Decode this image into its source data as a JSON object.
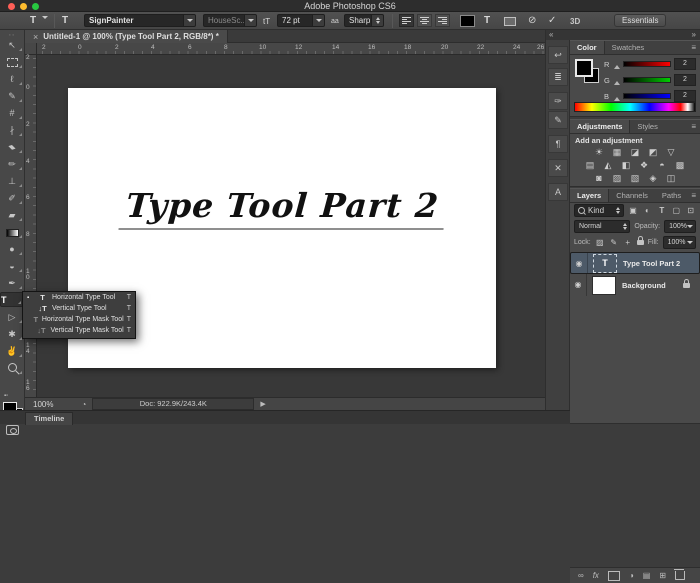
{
  "titlebar": {
    "title": "Adobe Photoshop CS6"
  },
  "colors": {
    "mac_red": "#ff5f57",
    "mac_yellow": "#febc2e",
    "mac_green": "#28c840",
    "panel": "#4a4a4a",
    "canvas": "#ffffff",
    "selected_layer_row": "#4d5a68",
    "foreground_color": "#000000"
  },
  "options_bar": {
    "tool_preset_glyph": "T",
    "orientation_glyph": "T",
    "font_family": {
      "value": "SignPainter"
    },
    "font_style": {
      "value": "HouseSc..."
    },
    "size_icon": "tT",
    "font_size": {
      "value": "72 pt"
    },
    "anti_alias_icon": "aa",
    "anti_alias": {
      "value": "Sharp"
    },
    "cancel_glyph": "⊘",
    "commit_glyph": "✓",
    "threed_label": "3D",
    "workspace_label": "Essentials"
  },
  "toolbar": {
    "grip": "∙∙",
    "tools": [
      {
        "name": "move",
        "glyph": "↖"
      },
      {
        "name": "rectangular-marquee",
        "glyph": ""
      },
      {
        "name": "lasso",
        "glyph": "ℓ"
      },
      {
        "name": "quick-selection",
        "glyph": "✎"
      },
      {
        "name": "crop",
        "glyph": "#"
      },
      {
        "name": "eyedropper",
        "glyph": "∤"
      },
      {
        "name": "healing-brush",
        "glyph": "▰"
      },
      {
        "name": "brush",
        "glyph": "✏"
      },
      {
        "name": "clone-stamp",
        "glyph": "⊥"
      },
      {
        "name": "history-brush",
        "glyph": "✐"
      },
      {
        "name": "eraser",
        "glyph": "▰"
      },
      {
        "name": "gradient",
        "glyph": ""
      },
      {
        "name": "blur",
        "glyph": "●"
      },
      {
        "name": "dodge",
        "glyph": "◒"
      },
      {
        "name": "pen",
        "glyph": "✒"
      },
      {
        "name": "type",
        "glyph": "T"
      },
      {
        "name": "path-selection",
        "glyph": "▷"
      },
      {
        "name": "custom-shape",
        "glyph": "✱"
      },
      {
        "name": "hand",
        "glyph": "✌"
      },
      {
        "name": "zoom",
        "glyph": ""
      }
    ]
  },
  "tool_flyout": {
    "bullet": "▪",
    "items": [
      {
        "icon": "T",
        "label": "Horizontal Type Tool",
        "shortcut": "T",
        "selected": true
      },
      {
        "icon": "↓T",
        "label": "Vertical Type Tool",
        "shortcut": "T",
        "selected": false
      },
      {
        "icon": "T",
        "label": "Horizontal Type Mask Tool",
        "shortcut": "T",
        "selected": false
      },
      {
        "icon": "↓T",
        "label": "Vertical Type Mask Tool",
        "shortcut": "T",
        "selected": false
      }
    ]
  },
  "document": {
    "tab": {
      "close": "×",
      "title": "Untitled-1 @ 100% (Type Tool Part 2, RGB/8*) *"
    },
    "canvas_text": "Type Tool Part 2",
    "ruler_h": [
      "2",
      "0",
      "2",
      "4",
      "6",
      "8",
      "10",
      "12",
      "14",
      "16",
      "18",
      "20",
      "22",
      "24",
      "26"
    ],
    "ruler_v": [
      "2",
      "0",
      "2",
      "4",
      "6",
      "8",
      "1\n0",
      "1\n2",
      "1\n4",
      "1\n6"
    ],
    "status": {
      "zoom": "100%",
      "badge": "◔",
      "doc": "Doc: 922.9K/243.4K",
      "arrow": "▶"
    }
  },
  "timeline": {
    "tab_label": "Timeline"
  },
  "dock_strip": {
    "collapse_glyph": "«",
    "icons": [
      {
        "name": "history-panel",
        "glyph": "↩"
      },
      {
        "name": "properties-panel",
        "glyph": "≣"
      },
      {
        "name": "brush-panel",
        "glyph": "✑"
      },
      {
        "name": "brush-presets-panel",
        "glyph": "✎"
      },
      {
        "name": "paragraph-panel",
        "glyph": "¶"
      },
      {
        "name": "tool-presets-panel",
        "glyph": "✕"
      },
      {
        "name": "character-panel",
        "glyph": "A"
      }
    ]
  },
  "panels": {
    "collapse_glyph": "»",
    "color": {
      "tabs": [
        "Color",
        "Swatches"
      ],
      "menu_icon": "≡",
      "channels": [
        {
          "label": "R",
          "value": "2"
        },
        {
          "label": "G",
          "value": "2"
        },
        {
          "label": "B",
          "value": "2"
        }
      ]
    },
    "adjustments": {
      "tabs": [
        "Adjustments",
        "Styles"
      ],
      "menu_icon": "≡",
      "heading": "Add an adjustment",
      "icons": [
        {
          "name": "brightness-contrast",
          "glyph": "☀"
        },
        {
          "name": "levels",
          "glyph": "▦"
        },
        {
          "name": "curves",
          "glyph": "◪"
        },
        {
          "name": "exposure",
          "glyph": "◩"
        },
        {
          "name": "vibrance",
          "glyph": "▽"
        },
        {
          "name": "hue-saturation",
          "glyph": "▤"
        },
        {
          "name": "color-balance",
          "glyph": "◭"
        },
        {
          "name": "black-white",
          "glyph": "◧"
        },
        {
          "name": "photo-filter",
          "glyph": "❖"
        },
        {
          "name": "channel-mixer",
          "glyph": "◓"
        },
        {
          "name": "color-lookup",
          "glyph": "▩"
        },
        {
          "name": "invert",
          "glyph": "◙"
        },
        {
          "name": "posterize",
          "glyph": "▨"
        },
        {
          "name": "threshold",
          "glyph": "▧"
        },
        {
          "name": "gradient-map",
          "glyph": "◈"
        },
        {
          "name": "selective-color",
          "glyph": "◫"
        }
      ]
    },
    "layers": {
      "tabs": [
        "Layers",
        "Channels",
        "Paths"
      ],
      "menu_icon": "≡",
      "filter": {
        "label": "Kind",
        "icons": [
          {
            "name": "pixel-layer-filter",
            "glyph": "▣"
          },
          {
            "name": "adjustment-layer-filter",
            "glyph": "◐"
          },
          {
            "name": "type-layer-filter",
            "glyph": "T"
          },
          {
            "name": "shape-layer-filter",
            "glyph": "▢"
          },
          {
            "name": "smart-object-filter",
            "glyph": "⊡"
          }
        ]
      },
      "blend_mode": "Normal",
      "opacity_label": "Opacity:",
      "opacity_value": "100%",
      "lock_label": "Lock:",
      "lock_icons": [
        {
          "name": "lock-transparent-pixels",
          "glyph": "▨"
        },
        {
          "name": "lock-image-pixels",
          "glyph": "✎"
        },
        {
          "name": "lock-position",
          "glyph": "+"
        }
      ],
      "fill_label": "Fill:",
      "fill_value": "100%",
      "eye_glyph": "◉",
      "rows": [
        {
          "name": "Type Tool Part 2",
          "thumb": "T",
          "selected": true
        },
        {
          "name": "Background",
          "locked": true
        }
      ],
      "bottom_icons": [
        {
          "name": "link-layers",
          "glyph": "∞"
        },
        {
          "name": "layer-style",
          "glyph": "fx"
        },
        {
          "name": "add-layer-mask",
          "glyph": ""
        },
        {
          "name": "new-adjustment-layer",
          "glyph": "◑"
        },
        {
          "name": "new-group",
          "glyph": "▤"
        },
        {
          "name": "new-layer",
          "glyph": "⊞"
        },
        {
          "name": "delete-layer",
          "glyph": ""
        }
      ]
    }
  }
}
